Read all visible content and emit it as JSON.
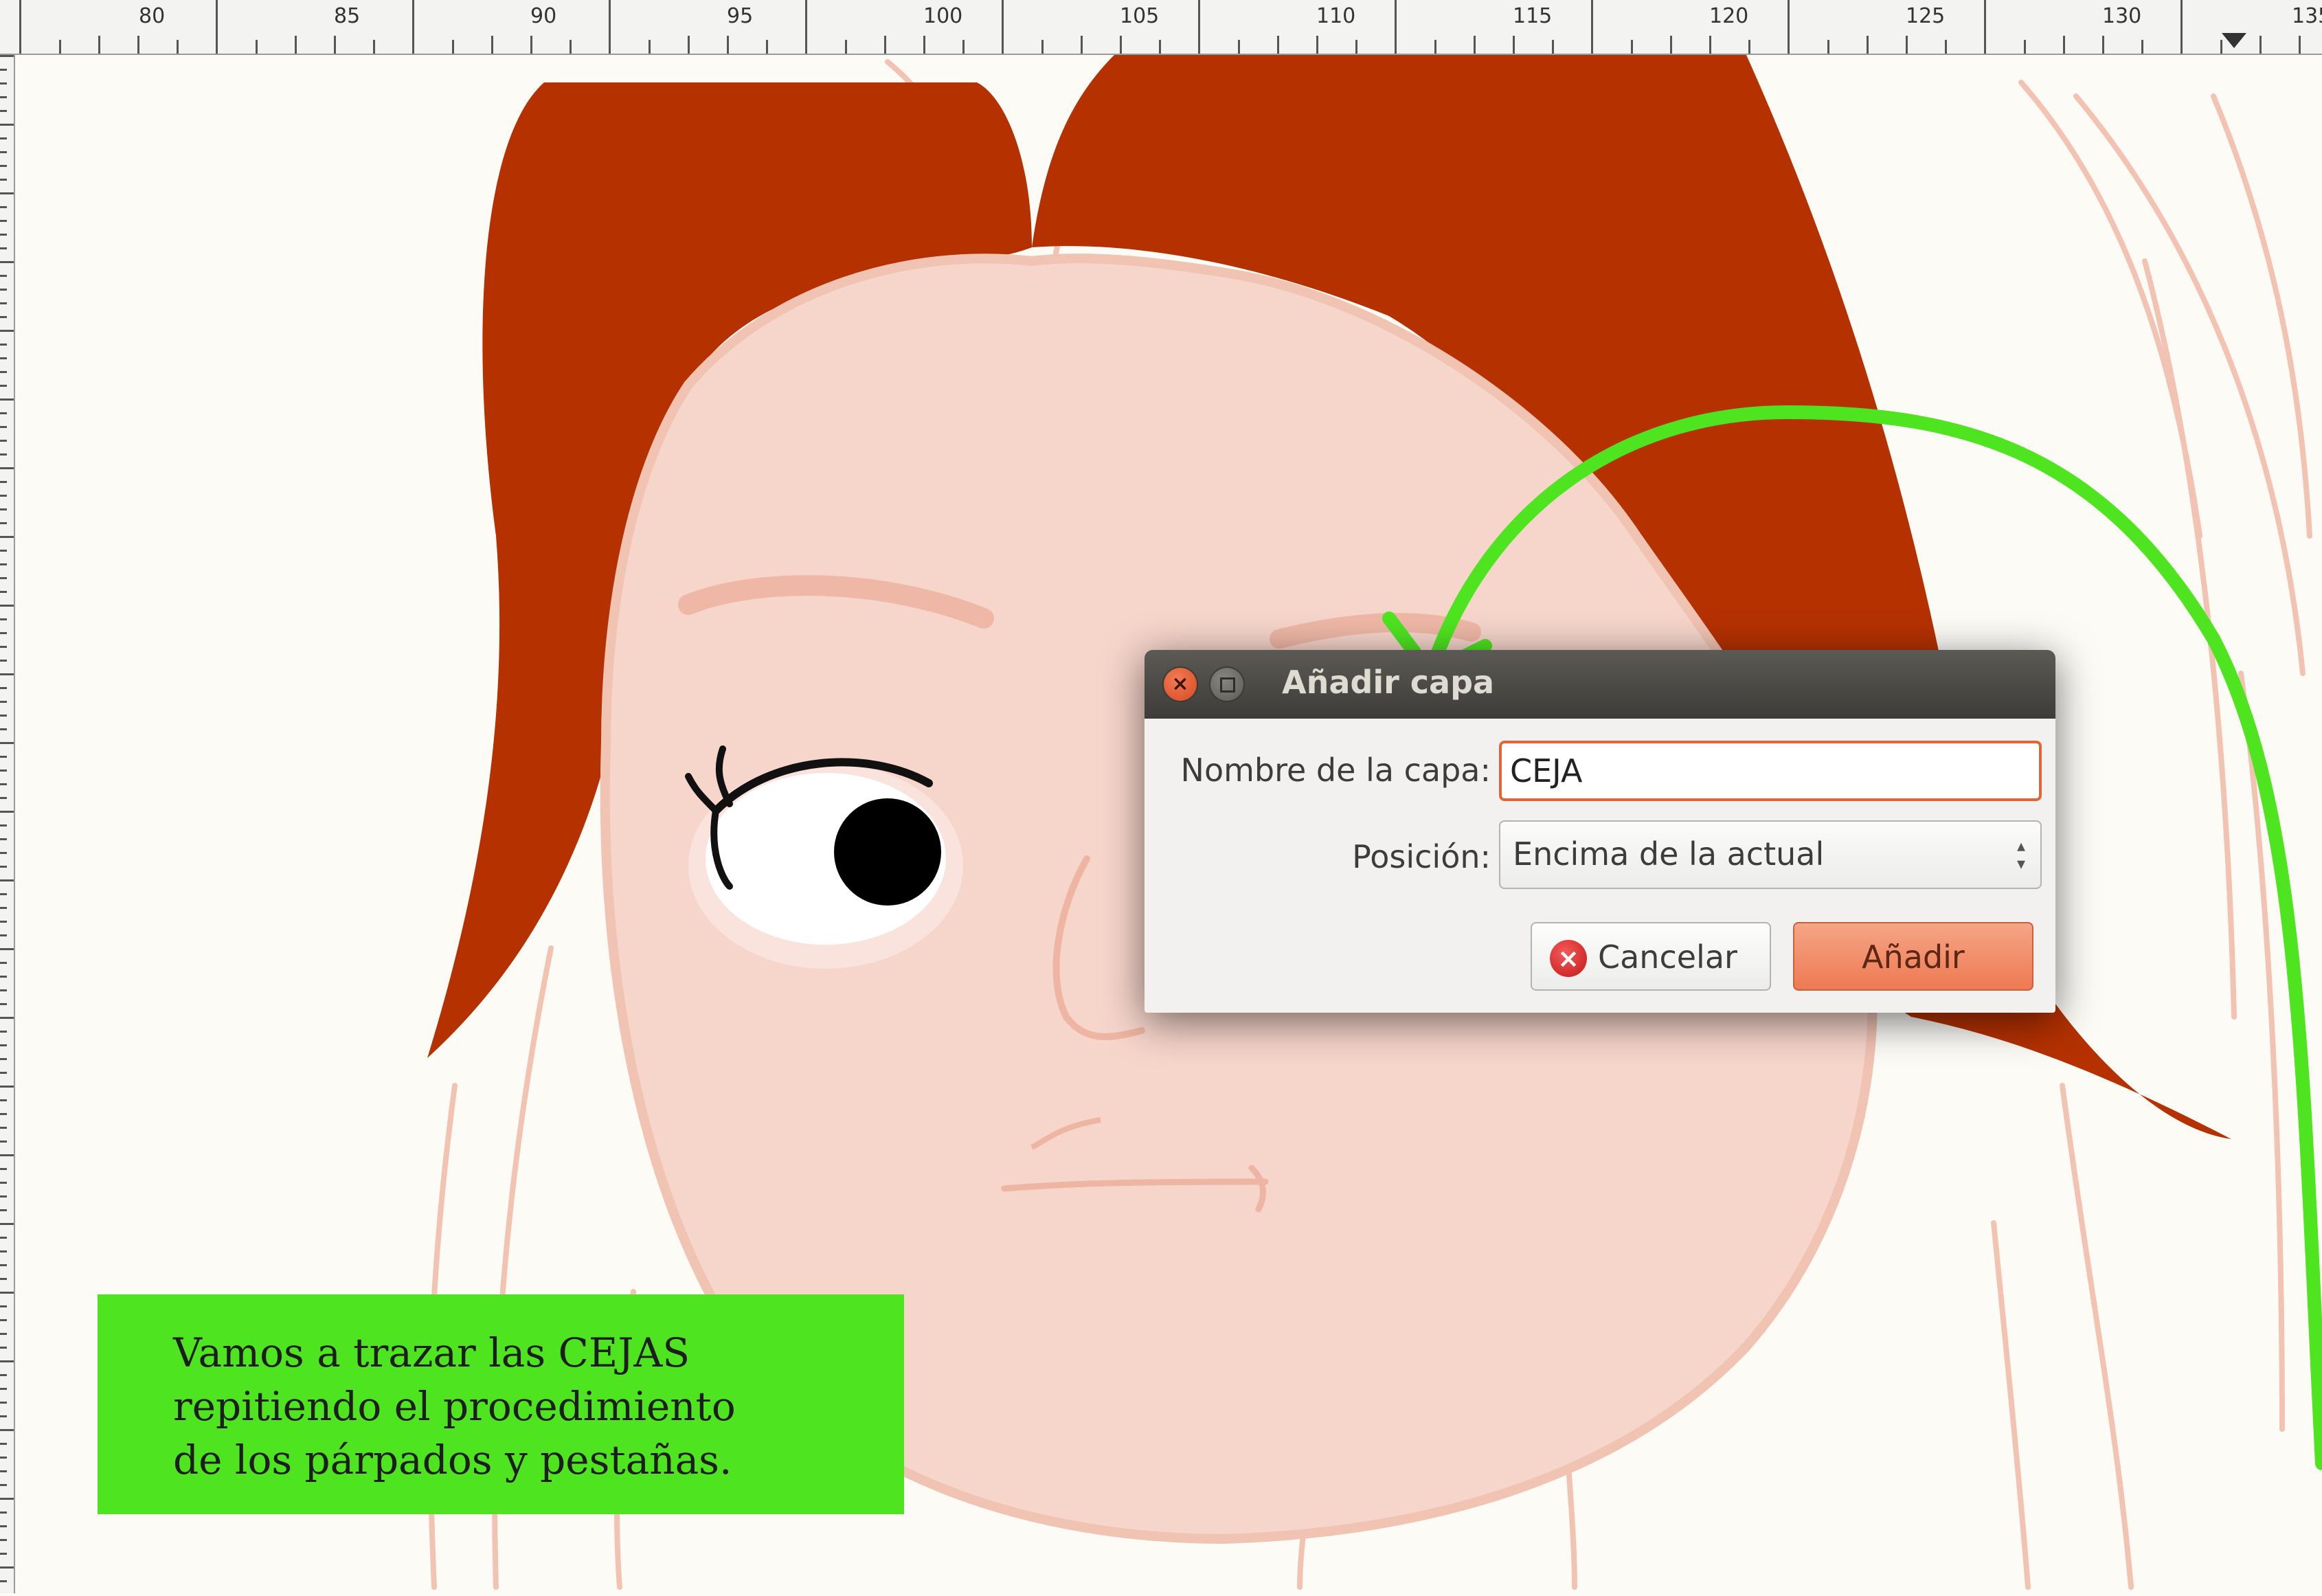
{
  "ruler": {
    "labels": [
      "80",
      "85",
      "90",
      "95",
      "100",
      "105",
      "110",
      "115",
      "120",
      "125",
      "130",
      "135"
    ]
  },
  "dialog": {
    "title": "Añadir capa",
    "name_label": "Nombre de la capa:",
    "name_value": "CEJA",
    "position_label": "Posición:",
    "position_value": "Encima de la actual",
    "cancel_label": "Cancelar",
    "add_label": "Añadir"
  },
  "note": {
    "lines": [
      "Vamos a trazar las CEJAS",
      "repitiendo el procedimiento",
      "de los párpados y pestañas."
    ]
  },
  "colors": {
    "hair": "#b53100",
    "skin": "#f6d5cb",
    "sketch": "#eeb5a2",
    "annotation_green": "#4ee420",
    "dialog_titlebar": "#3d3c38",
    "accent_orange": "#e2653a"
  }
}
